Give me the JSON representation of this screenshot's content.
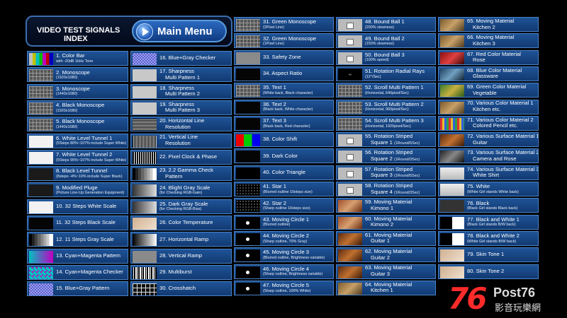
{
  "header": {
    "title_line1": "VIDEO TEST SIGNALS",
    "title_line2": "INDEX",
    "main_menu_label": "Main Menu"
  },
  "columns": [
    {
      "items": [
        {
          "label": "1. Color Bar",
          "sub": "with -20dB 1kHz Tone",
          "thumb": "bars"
        },
        {
          "label": "2. Monoscope",
          "sub": "(1920x1080)",
          "thumb": "grid"
        },
        {
          "label": "3. Monoscope",
          "sub": "(1440x1080)",
          "thumb": "grid"
        },
        {
          "label": "4. Black Monoscope",
          "sub": "(1920x1080)",
          "thumb": "grid"
        },
        {
          "label": "5. Black Monoscope",
          "sub": "(1440x1080)",
          "thumb": "grid"
        },
        {
          "label": "6. White Level Tunnel 1",
          "sub": "(5Steps 80%~107% include Super White)",
          "thumb": "white"
        },
        {
          "label": "7. White Level Tunnel 2",
          "sub": "(5Steps 95%~107% include Super White)",
          "thumb": "white"
        },
        {
          "label": "8. Black Level Tunnel",
          "sub": "(8steps -4%~10% include Super Black)",
          "thumb": "dark"
        },
        {
          "label": "9. Modified Pluge",
          "sub": "(Picture Line-Up Generation Equipment)",
          "thumb": "dark"
        },
        {
          "label": "10. 32 Steps White Scale",
          "sub": "",
          "thumb": "white"
        },
        {
          "label": "11. 32 Steps Black Scale",
          "sub": "",
          "thumb": "black"
        },
        {
          "label": "12. 11 Steps Gray Scale",
          "sub": "",
          "thumb": "steps"
        },
        {
          "label": "13. Cyan+Magenta Pattern",
          "sub": "",
          "thumb": "cm"
        },
        {
          "label": "14. Cyan+Magenta Checker",
          "sub": "",
          "thumb": "cmcheck"
        },
        {
          "label": "15. Blue+Gray Pattern",
          "sub": "",
          "thumb": "check"
        }
      ]
    },
    {
      "items": [
        {
          "label": "16. Blue+Gray Checker",
          "sub": "",
          "thumb": "check"
        },
        {
          "label": "17. Sharpness",
          "sub2": "Multi Pattern 1",
          "thumb": "lgray"
        },
        {
          "label": "18. Sharpness",
          "sub2": "Multi Pattern 2",
          "thumb": "lgray"
        },
        {
          "label": "19. Sharpness",
          "sub2": "Multi Pattern 3",
          "thumb": "lgray"
        },
        {
          "label": "20. Horizontal Line",
          "sub2": "Resolution",
          "thumb": "hline"
        },
        {
          "label": "21. Vertical Line",
          "sub2": "Resolution",
          "thumb": "vline"
        },
        {
          "label": "22. Pixel Clock & Phase",
          "sub": "",
          "thumb": "clock"
        },
        {
          "label": "23. 2.2 Gamma Check",
          "sub2": "Pattern",
          "thumb": "steps"
        },
        {
          "label": "24. Blight Gray Scale",
          "sub": "(for Checking RGB-Gain)",
          "thumb": "gain"
        },
        {
          "label": "25. Dark Gray Scale",
          "sub": "(for Checking RGB-Bias)",
          "thumb": "gain"
        },
        {
          "label": "26. Color Temperature",
          "sub": "",
          "thumb": "person"
        },
        {
          "label": "27. Horizontal Ramp",
          "sub": "",
          "thumb": "ramp"
        },
        {
          "label": "28. Vertical Ramp",
          "sub": "",
          "thumb": "gray"
        },
        {
          "label": "29. Multiburst",
          "sub": "",
          "thumb": "multi"
        },
        {
          "label": "30. Crosshatch",
          "sub": "",
          "thumb": "cross"
        }
      ]
    },
    {
      "items": [
        {
          "label": "31. Green Monoscope",
          "sub": "(2Pixel Line)",
          "thumb": "grid"
        },
        {
          "label": "32. Green Monoscope",
          "sub": "(1Pixel Line)",
          "thumb": "grid"
        },
        {
          "label": "33. Safety Zone",
          "sub": "",
          "thumb": "gray"
        },
        {
          "label": "34. Aspect Ratio",
          "sub": "",
          "thumb": "black"
        },
        {
          "label": "35. Text 1",
          "sub": "(White back, Black character)",
          "thumb": "grid"
        },
        {
          "label": "36. Text 2",
          "sub": "(Black back, White character)",
          "thumb": "black"
        },
        {
          "label": "37. Text 3",
          "sub": "(Black back, Red character)",
          "thumb": "black"
        },
        {
          "label": "38. Color Shift",
          "sub": "",
          "thumb": "colorshift"
        },
        {
          "label": "39. Dark Color",
          "sub": "",
          "thumb": "black"
        },
        {
          "label": "40. Color Triangle",
          "sub": "",
          "thumb": "tri"
        },
        {
          "label": "41. Star 1",
          "sub": "(Blurred outline 10steps size)",
          "thumb": "stars"
        },
        {
          "label": "42. Star 2",
          "sub": "(Sharp outline 10steps size)",
          "thumb": "stars"
        },
        {
          "label": "43. Moving Circle 1",
          "sub": "(Blurred outline)",
          "thumb": "circle"
        },
        {
          "label": "44. Moving Circle 2",
          "sub": "(Sharp outline, 70% Gray)",
          "thumb": "circle"
        },
        {
          "label": "45. Moving Circle 3",
          "sub": "(Blurred outline, Brightness variable)",
          "thumb": "circle"
        },
        {
          "label": "46. Moving Circle 4",
          "sub": "(Sharp outline, Brightness variable)",
          "thumb": "circle"
        },
        {
          "label": "47. Moving Circle 5",
          "sub": "(Sharp outline, 100% White)",
          "thumb": "circle"
        }
      ]
    },
    {
      "items": [
        {
          "label": "48. Bound Ball 1",
          "sub": "(200% slowness)",
          "thumb": "ball"
        },
        {
          "label": "49. Bound Ball 2",
          "sub": "(150% slowness)",
          "thumb": "ball"
        },
        {
          "label": "50. Bound Ball 3",
          "sub": "(100% speed)",
          "thumb": "ball"
        },
        {
          "label": "51. Rotation Radial Rays",
          "sub": "(12°/Sec)",
          "thumb": "radial"
        },
        {
          "label": "52. Scroll Multi Pattern 1",
          "sub": "(Horizontal, 640pixel/Sec)",
          "thumb": "grid"
        },
        {
          "label": "53. Scroll Multi Pattern 2",
          "sub": "(Horizontal, 960pixel/Sec)",
          "thumb": "grid"
        },
        {
          "label": "54. Scroll Multi Pattern 3",
          "sub": "(Horizontal, 1920pixel/Sec)",
          "thumb": "grid"
        },
        {
          "label": "55. Rotation Striped",
          "sub2": "Square 1",
          "subx": "(1Round/5Sec)",
          "thumb": "ball"
        },
        {
          "label": "56. Rotation Striped",
          "sub2": "Square 2",
          "subx": "(1Round/3Sec)",
          "thumb": "ball"
        },
        {
          "label": "57. Rotation Striped",
          "sub2": "Square 3",
          "subx": "(1Round/5Sec)",
          "thumb": "ball"
        },
        {
          "label": "58. Rotation Striped",
          "sub2": "Square 4",
          "subx": "(1Round/3Sec)",
          "thumb": "ball"
        },
        {
          "label": "59. Moving Material",
          "sub2": "Kimono 1",
          "thumb": "kimono"
        },
        {
          "label": "60. Moving Material",
          "sub2": "Kimono 2",
          "thumb": "kimono"
        },
        {
          "label": "61. Moving Material",
          "sub2": "Guitar 1",
          "thumb": "guitar"
        },
        {
          "label": "62. Moving Material",
          "sub2": "Guitar 2",
          "thumb": "guitar"
        },
        {
          "label": "63. Moving Material",
          "sub2": "Guitar 3",
          "thumb": "guitar"
        },
        {
          "label": "64. Moving Material",
          "sub2": "Kitchen 1",
          "thumb": "kitchen"
        }
      ]
    },
    {
      "items": [
        {
          "label": "65. Moving Material",
          "sub2": "Kitchen 2",
          "thumb": "kitchen"
        },
        {
          "label": "66. Moving Material",
          "sub2": "Kitchen 3",
          "thumb": "kitchen"
        },
        {
          "label": "67. Red Color Material",
          "sub2": "Rose",
          "thumb": "rose"
        },
        {
          "label": "68. Blue Color Material",
          "sub2": "Glassware",
          "thumb": "glass"
        },
        {
          "label": "69. Green Color Material",
          "sub2": "Vegetable",
          "thumb": "veg"
        },
        {
          "label": "70. Various Color Material 1",
          "sub2": "Kitchen etc.",
          "thumb": "kitchen"
        },
        {
          "label": "71. Various Color Material 2",
          "sub2": "Colored Pencil etc.",
          "thumb": "pencil"
        },
        {
          "label": "72. Various Surface Material 1",
          "sub2": "Guitar",
          "thumb": "guitar"
        },
        {
          "label": "73. Various Surface Material 2",
          "sub2": "Camera and Rose",
          "thumb": "camera"
        },
        {
          "label": "74. Various Surface Material 3",
          "sub2": "White Shirt",
          "thumb": "shirt"
        },
        {
          "label": "75. White",
          "sub": "(White Girl stands White back)",
          "thumb": "shirt"
        },
        {
          "label": "76. Black",
          "sub": "(Black Girl stands Black back)",
          "thumb": "darkperson"
        },
        {
          "label": "77. Black and White 1",
          "sub": "(Black Girl stands B/W back)",
          "thumb": "bw"
        },
        {
          "label": "78. Black and White 2",
          "sub": "(White Girl stands B/W back)",
          "thumb": "bw"
        },
        {
          "label": "79. Skin Tone 1",
          "sub": "",
          "thumb": "person"
        },
        {
          "label": "80. Skin Tone 2",
          "sub": "",
          "thumb": "person"
        }
      ]
    }
  ],
  "logo": {
    "number": "76",
    "text": "Post76",
    "cn": "影音玩樂網"
  },
  "colors": {
    "accent": "#4a83c8",
    "cell_top": "#1f5396",
    "cell_bottom": "#123a72",
    "logo_red": "#ff2b2b"
  }
}
